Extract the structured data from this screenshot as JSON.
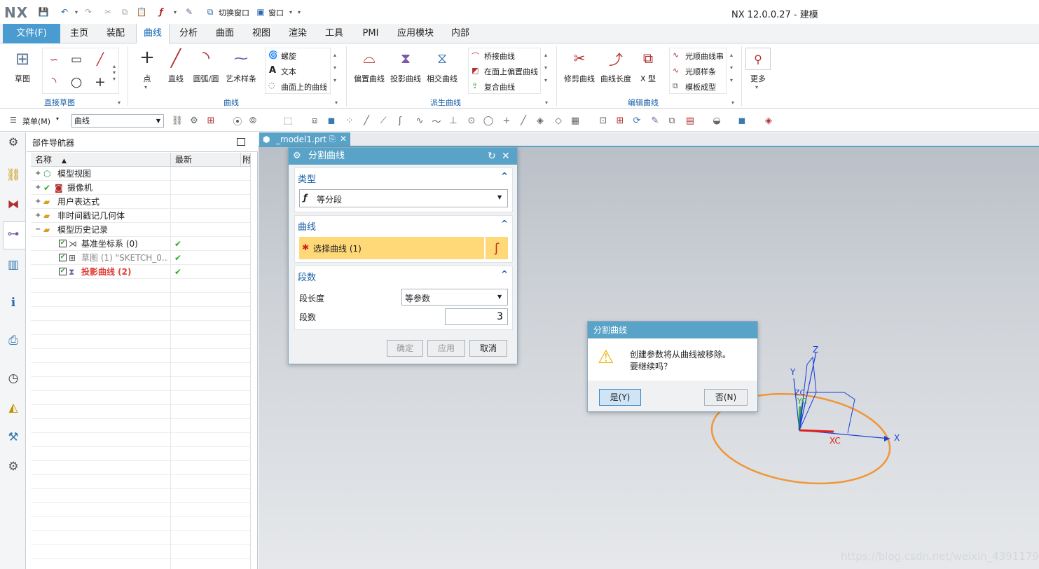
{
  "app": {
    "logo": "NX",
    "title": "NX 12.0.0.27 - 建模"
  },
  "quick_access": {
    "switch_window": "切换窗口",
    "window": "窗口"
  },
  "menu": {
    "file": "文件(F)",
    "tabs": [
      "主页",
      "装配",
      "曲线",
      "分析",
      "曲面",
      "视图",
      "渲染",
      "工具",
      "PMI",
      "应用模块",
      "内部"
    ],
    "active": "曲线"
  },
  "ribbon": {
    "groups": {
      "direct_sketch": "直接草图",
      "curve": "曲线",
      "derived_curve": "派生曲线",
      "edit_curve": "编辑曲线"
    },
    "sketch": "草图",
    "point": "点",
    "line": "直线",
    "arc": "圆弧/圆",
    "studio_spline": "艺术样条",
    "helix": "螺旋",
    "text": "文本",
    "curve_on_surface": "曲面上的曲线",
    "offset_curve": "偏置曲线",
    "project_curve": "投影曲线",
    "intersection_curve": "相交曲线",
    "bridge_curve": "桥接曲线",
    "offset_in_face": "在面上偏置曲线",
    "composite_curve": "复合曲线",
    "trim_curve": "修剪曲线",
    "curve_length": "曲线长度",
    "x_form": "X 型",
    "smooth_string": "光顺曲线串",
    "smooth_spline": "光顺样条",
    "template_shape": "模板成型",
    "more": "更多"
  },
  "toolbar2": {
    "menu": "菜单(M)",
    "filter": "曲线"
  },
  "navigator": {
    "title": "部件导航器",
    "col_name": "名称",
    "col_latest": "最新",
    "col_extra": "附",
    "items": [
      {
        "label": "模型视图"
      },
      {
        "label": "摄像机"
      },
      {
        "label": "用户表达式"
      },
      {
        "label": "非时间戳记几何体"
      },
      {
        "label": "模型历史记录"
      },
      {
        "label": "基准坐标系 (0)"
      },
      {
        "label": "草图 (1) \"SKETCH_0..."
      },
      {
        "label": "投影曲线 (2)"
      }
    ]
  },
  "viewport": {
    "tab": "_model1.prt",
    "axes": {
      "x": "X",
      "y": "Y",
      "z": "Z",
      "xc": "XC",
      "yc": "YC",
      "zc": "ZC"
    },
    "watermark": "https://blog.csdn.net/weixin_43911798"
  },
  "divide_dialog": {
    "title": "分割曲线",
    "type_section": "类型",
    "type_value": "等分段",
    "curve_section": "曲线",
    "select_curve": "选择曲线 (1)",
    "segments_section": "段数",
    "segment_length_label": "段长度",
    "segment_length_value": "等参数",
    "segment_count_label": "段数",
    "segment_count_value": "3",
    "ok": "确定",
    "apply": "应用",
    "cancel": "取消"
  },
  "confirm_dialog": {
    "title": "分割曲线",
    "message_line1": "创建参数将从曲线被移除。",
    "message_line2": "要继续吗？",
    "yes": "是(Y)",
    "no": "否(N)"
  }
}
